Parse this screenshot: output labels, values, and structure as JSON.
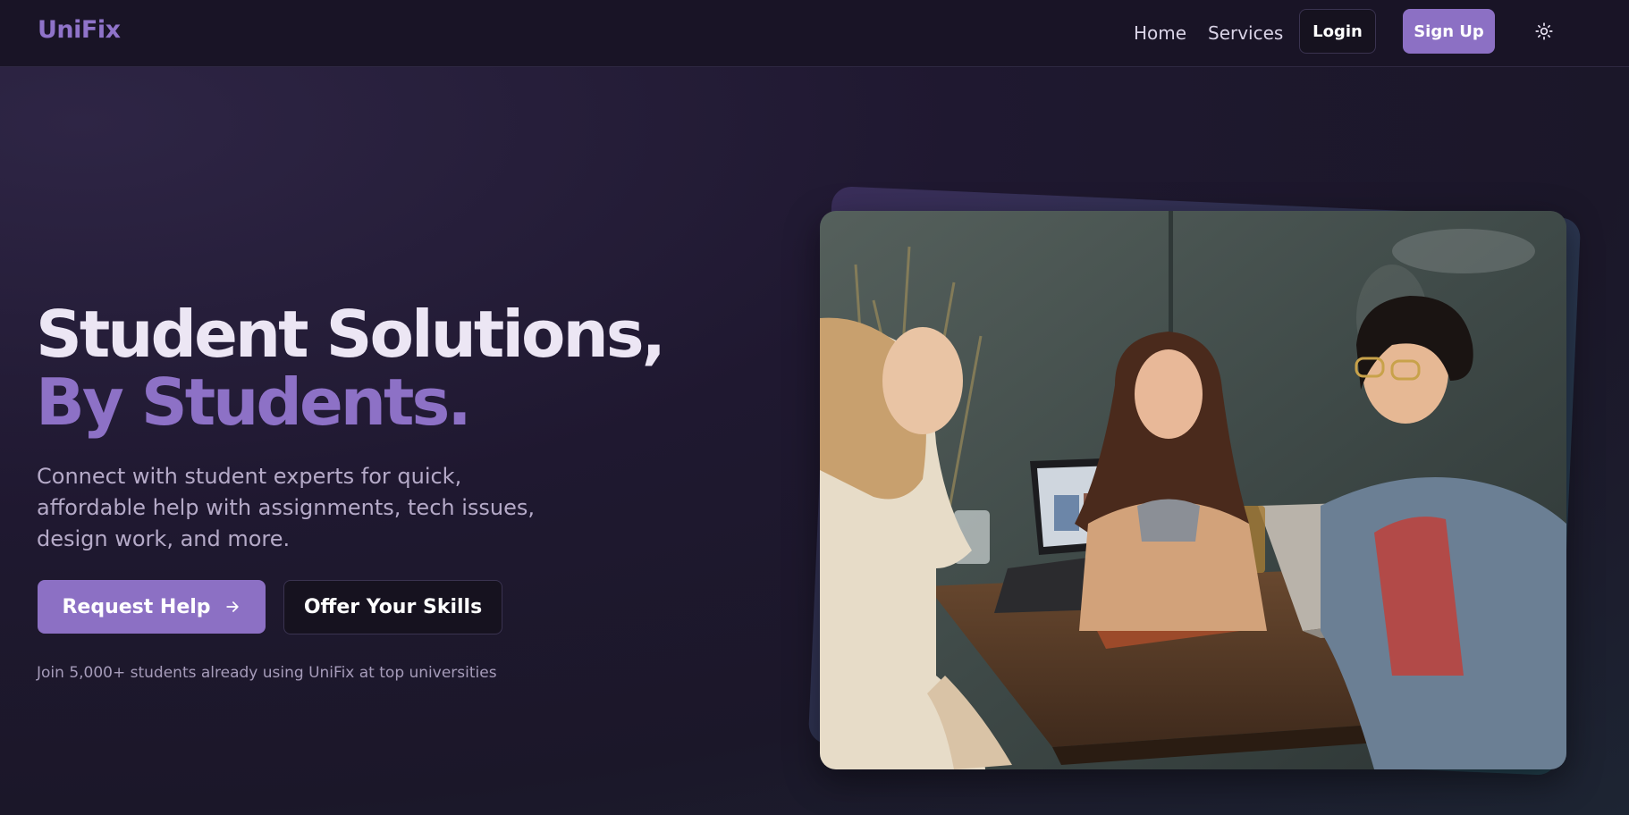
{
  "brand": {
    "name": "UniFix"
  },
  "nav": {
    "home_label": "Home",
    "services_label": "Services",
    "login_label": "Login",
    "signup_label": "Sign Up",
    "theme_icon": "sun-icon"
  },
  "hero": {
    "title_line1": "Student Solutions,",
    "title_line2": "By Students.",
    "subtitle": "Connect with student experts for quick, affordable help with assignments, tech issues, design work, and more.",
    "primary_cta": "Request Help",
    "primary_cta_icon": "arrow-right-icon",
    "secondary_cta": "Offer Your Skills",
    "social_proof": "Join 5,000+ students already using UniFix at top universities"
  },
  "colors": {
    "accent": "#8c70c4",
    "background": "#1f1830",
    "navbar": "#191426",
    "heading": "#ece6f4",
    "muted_text": "#b5aac8"
  }
}
